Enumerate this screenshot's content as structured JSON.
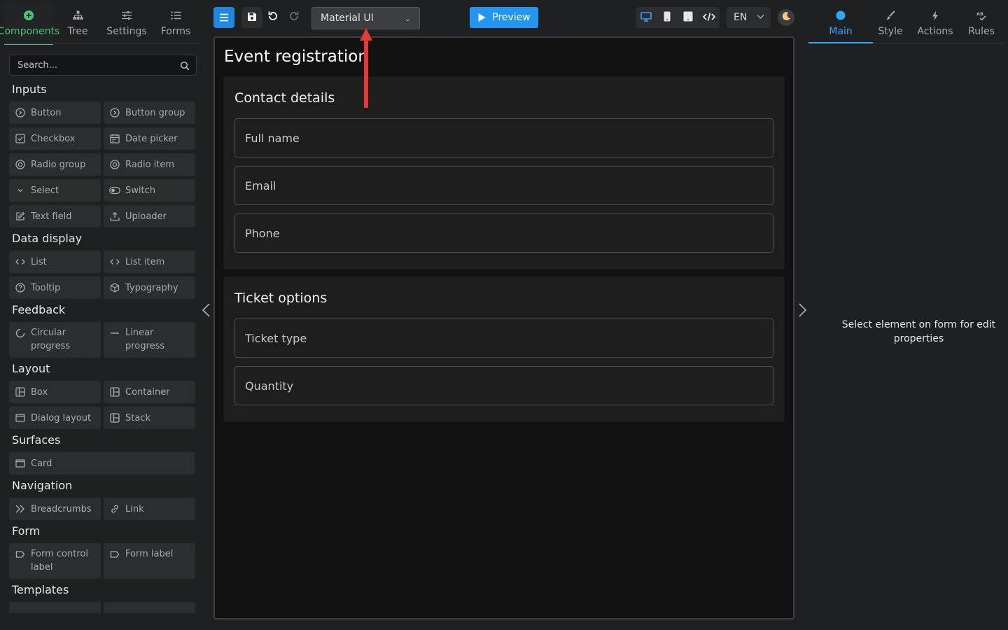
{
  "left_tabs": [
    {
      "label": "Components",
      "icon": "plus-circle-icon"
    },
    {
      "label": "Tree",
      "icon": "hierarchy-icon"
    },
    {
      "label": "Settings",
      "icon": "sliders-icon"
    },
    {
      "label": "Forms",
      "icon": "list-icon"
    }
  ],
  "search": {
    "placeholder": "Search..."
  },
  "sections": {
    "inputs": {
      "title": "Inputs",
      "items": [
        "Button",
        "Button group",
        "Checkbox",
        "Date picker",
        "Radio group",
        "Radio item",
        "Select",
        "Switch",
        "Text field",
        "Uploader"
      ]
    },
    "data_display": {
      "title": "Data display",
      "items": [
        "List",
        "List item",
        "Tooltip",
        "Typography"
      ]
    },
    "feedback": {
      "title": "Feedback",
      "items": [
        "Circular progress",
        "Linear progress"
      ]
    },
    "layout": {
      "title": "Layout",
      "items": [
        "Box",
        "Container",
        "Dialog layout",
        "Stack"
      ]
    },
    "surfaces": {
      "title": "Surfaces",
      "items": [
        "Card"
      ]
    },
    "navigation": {
      "title": "Navigation",
      "items": [
        "Breadcrumbs",
        "Link"
      ]
    },
    "form": {
      "title": "Form",
      "items": [
        "Form control label",
        "Form label"
      ]
    },
    "templates": {
      "title": "Templates"
    }
  },
  "toolbar": {
    "theme_select": "Material UI",
    "preview_label": "Preview",
    "language": "EN"
  },
  "canvas": {
    "form_title": "Event registration",
    "contact": {
      "title": "Contact details",
      "fields": [
        "Full name",
        "Email",
        "Phone"
      ]
    },
    "ticket": {
      "title": "Ticket options",
      "fields": [
        "Ticket type",
        "Quantity"
      ]
    }
  },
  "right_tabs": [
    {
      "label": "Main",
      "icon": "circle-icon"
    },
    {
      "label": "Style",
      "icon": "brush-icon"
    },
    {
      "label": "Actions",
      "icon": "lightning-icon"
    },
    {
      "label": "Rules",
      "icon": "rules-icon"
    }
  ],
  "right_panel": {
    "empty_message": "Select element on form for edit properties"
  },
  "colors": {
    "components_tab_accent": "#48c774",
    "main_tab_accent": "#2ea8ff",
    "preview_button": "#2196f3",
    "annotation_arrow": "#e53935"
  }
}
